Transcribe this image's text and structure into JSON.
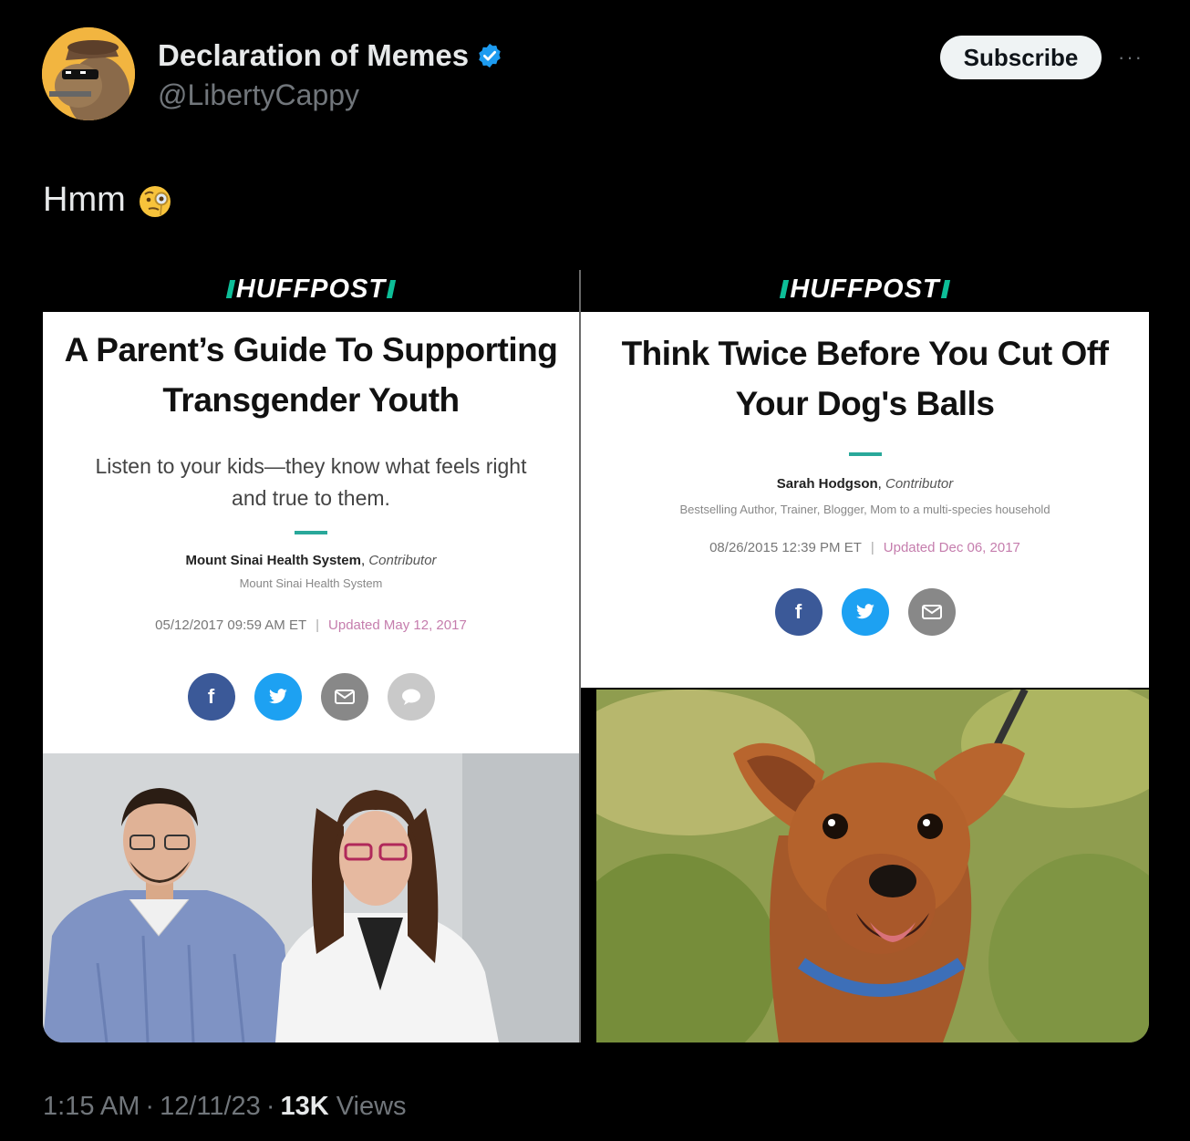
{
  "author": {
    "name": "Declaration of Memes",
    "handle": "@LibertyCappy",
    "avatar_icon": "capybara-avatar-icon",
    "verified_icon": "verified-badge-icon",
    "verified_color": "#1d9bf0"
  },
  "actions": {
    "subscribe_label": "Subscribe",
    "more_label": "···"
  },
  "tweet": {
    "text": "Hmm",
    "emoji_icon": "face-with-monocle-icon"
  },
  "media": {
    "left": {
      "brand": "HUFFPOST",
      "headline_line1": "A Parent’s Guide To Supporting",
      "headline_line2": "Transgender Youth",
      "subhead_line1": "Listen to your kids—they know what feels right",
      "subhead_line2": "and true to them.",
      "author": "Mount Sinai Health System",
      "author_role": "Contributor",
      "affiliation": "Mount Sinai Health System",
      "date": "05/12/2017 09:59 AM ET",
      "separator": "|",
      "updated": "Updated May 12, 2017",
      "share_icons": [
        "facebook-icon",
        "twitter-icon",
        "mail-icon",
        "comment-icon"
      ],
      "share_labels": {
        "facebook": "f"
      },
      "photo": "two-people-photo"
    },
    "right": {
      "brand": "HUFFPOST",
      "headline_line1": "Think Twice Before You Cut Off",
      "headline_line2": "Your Dog's Balls",
      "author": "Sarah Hodgson",
      "author_role": "Contributor",
      "affiliation": "Bestselling Author, Trainer, Blogger, Mom to a multi-species household",
      "date": "08/26/2015 12:39 PM ET",
      "separator": "|",
      "updated": "Updated Dec 06, 2017",
      "share_icons": [
        "facebook-icon",
        "twitter-icon",
        "mail-icon"
      ],
      "share_labels": {
        "facebook": "f"
      },
      "photo": "dog-photo"
    }
  },
  "meta": {
    "time": "1:15 AM",
    "date": "12/11/23",
    "views_count": "13K",
    "views_label": "Views",
    "dot": "·"
  },
  "colors": {
    "background": "#000000",
    "text_primary": "#e7e9ea",
    "text_secondary": "#71767b",
    "huffpost_teal": "#0dbe98"
  }
}
